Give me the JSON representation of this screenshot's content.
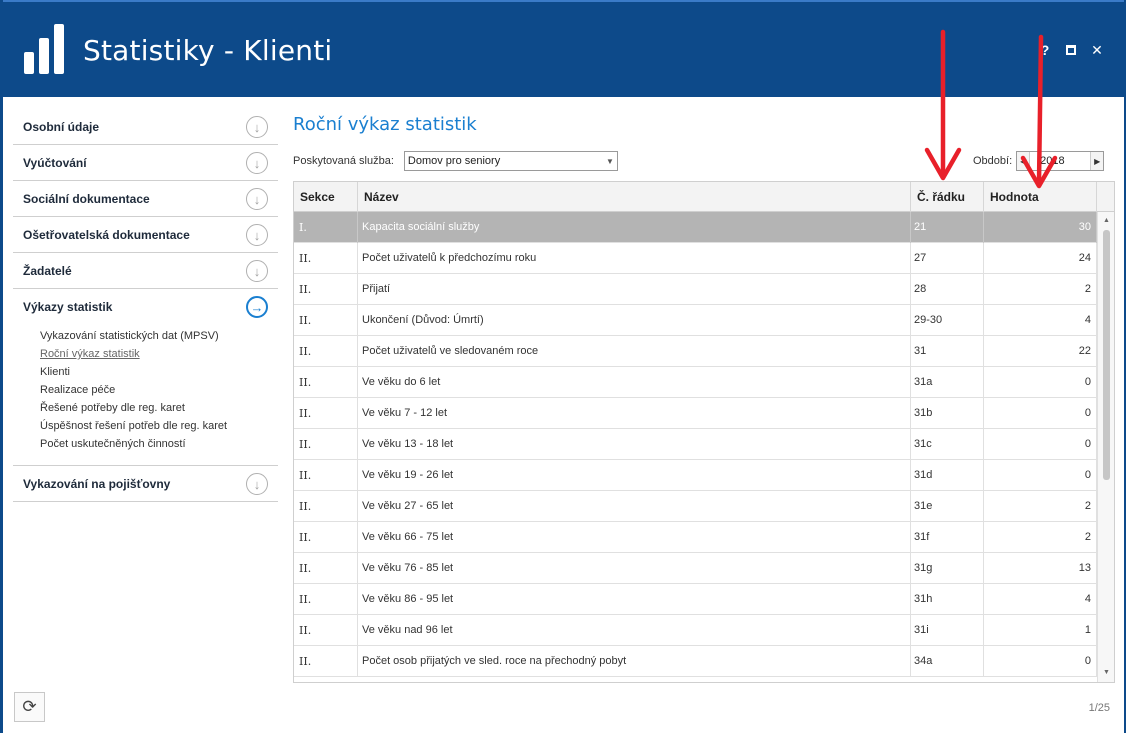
{
  "window": {
    "title": "Statistiky - Klienti",
    "controls": {
      "help": "?",
      "close": "✕"
    }
  },
  "sidebar": {
    "items": [
      {
        "label": "Osobní údaje",
        "icon": "arrow-down-circle-icon"
      },
      {
        "label": "Vyúčtování",
        "icon": "arrow-down-circle-icon"
      },
      {
        "label": "Sociální dokumentace",
        "icon": "arrow-down-circle-icon"
      },
      {
        "label": "Ošetřovatelská dokumentace",
        "icon": "arrow-down-circle-icon"
      },
      {
        "label": "Žadatelé",
        "icon": "arrow-down-circle-icon"
      },
      {
        "label": "Výkazy statistik",
        "icon": "arrow-right-circle-icon",
        "active": true
      },
      {
        "label": "Vykazování na pojišťovny",
        "icon": "arrow-down-circle-icon"
      }
    ],
    "subitems": [
      "Vykazování statistických dat (MPSV)",
      "Roční výkaz statistik",
      "Klienti",
      "Realizace péče",
      "Řešené potřeby dle reg. karet",
      "Úspěšnost řešení potřeb dle reg. karet",
      "Počet uskutečněných činností"
    ]
  },
  "main": {
    "title": "Roční výkaz statistik",
    "service_label": "Poskytovaná služba:",
    "service_value": "Domov pro seniory",
    "period_label": "Období:",
    "period_value": "2018"
  },
  "grid": {
    "headers": {
      "sekce": "Sekce",
      "nazev": "Název",
      "radek": "Č. řádku",
      "hodnota": "Hodnota"
    },
    "rows": [
      [
        "I.",
        "Kapacita sociální služby",
        "21",
        "30"
      ],
      [
        "II.",
        "Počet uživatelů k předchozímu roku",
        "27",
        "24"
      ],
      [
        "II.",
        "Přijatí",
        "28",
        "2"
      ],
      [
        "II.",
        "Ukončení (Důvod: Úmrtí)",
        "29-30",
        "4"
      ],
      [
        "II.",
        "Počet uživatelů ve sledovaném roce",
        "31",
        "22"
      ],
      [
        "II.",
        "Ve věku do 6 let",
        "31a",
        "0"
      ],
      [
        "II.",
        "Ve věku 7 - 12 let",
        "31b",
        "0"
      ],
      [
        "II.",
        "Ve věku 13 - 18 let",
        "31c",
        "0"
      ],
      [
        "II.",
        "Ve věku 19 - 26 let",
        "31d",
        "0"
      ],
      [
        "II.",
        "Ve věku 27 - 65 let",
        "31e",
        "2"
      ],
      [
        "II.",
        "Ve věku 66 - 75 let",
        "31f",
        "2"
      ],
      [
        "II.",
        "Ve věku 76 - 85 let",
        "31g",
        "13"
      ],
      [
        "II.",
        "Ve věku 86 - 95 let",
        "31h",
        "4"
      ],
      [
        "II.",
        "Ve věku nad 96 let",
        "31i",
        "1"
      ],
      [
        "II.",
        "Počet osob přijatých ve sled. roce na přechodný pobyt",
        "34a",
        "0"
      ]
    ],
    "selected_row": 0
  },
  "footer": {
    "pager": "1/25",
    "refresh_icon": "refresh-icon"
  },
  "colors": {
    "header": "#0d4a8a",
    "accent": "#1a7fd0",
    "selected_row": "#b4b4b4",
    "annotation_arrow": "#e8202a"
  }
}
